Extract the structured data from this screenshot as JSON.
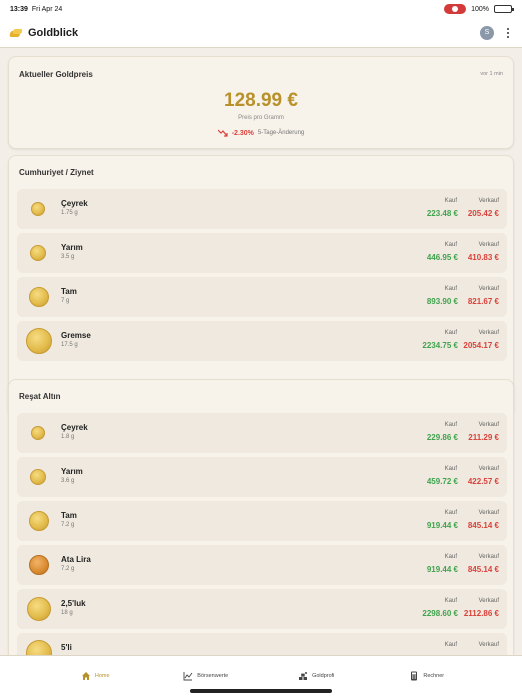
{
  "status": {
    "time": "13:39",
    "date": "Fri Apr 24",
    "battery": "100%"
  },
  "app": {
    "title": "Goldblick",
    "avatar_letter": "S"
  },
  "price_card": {
    "title": "Aktueller Goldpreis",
    "updated": "vor 1 min",
    "price": "128.99 €",
    "price_label": "Preis pro Gramm",
    "change_pct": "-2.30%",
    "change_label": "5-Tage-Änderung"
  },
  "labels": {
    "kauf": "Kauf",
    "verkauf": "Verkauf"
  },
  "sections": [
    {
      "title": "Cumhuriyet / Ziynet",
      "rows": [
        {
          "name": "Çeyrek",
          "weight": "1.75 g",
          "kauf": "223.48 €",
          "verkauf": "205.42 €"
        },
        {
          "name": "Yarım",
          "weight": "3.5 g",
          "kauf": "446.95 €",
          "verkauf": "410.83 €"
        },
        {
          "name": "Tam",
          "weight": "7 g",
          "kauf": "893.90 €",
          "verkauf": "821.67 €"
        },
        {
          "name": "Gremse",
          "weight": "17.5 g",
          "kauf": "2234.75 €",
          "verkauf": "2054.17 €"
        }
      ]
    },
    {
      "title": "Reşat Altın",
      "rows": [
        {
          "name": "Çeyrek",
          "weight": "1.8 g",
          "kauf": "229.86 €",
          "verkauf": "211.29 €"
        },
        {
          "name": "Yarım",
          "weight": "3.6 g",
          "kauf": "459.72 €",
          "verkauf": "422.57 €"
        },
        {
          "name": "Tam",
          "weight": "7.2 g",
          "kauf": "919.44 €",
          "verkauf": "845.14 €"
        },
        {
          "name": "Ata Lira",
          "weight": "7.2 g",
          "kauf": "919.44 €",
          "verkauf": "845.14 €"
        },
        {
          "name": "2,5'luk",
          "weight": "18 g",
          "kauf": "2298.60 €",
          "verkauf": "2112.86 €"
        },
        {
          "name": "5'li",
          "weight": "",
          "kauf": "",
          "verkauf": ""
        }
      ]
    }
  ],
  "nav": [
    {
      "label": "Home",
      "icon": "home-icon",
      "active": true
    },
    {
      "label": "Börsenwerte",
      "icon": "chart-icon",
      "active": false
    },
    {
      "label": "Goldprofi",
      "icon": "goldprofi-icon",
      "active": false
    },
    {
      "label": "Rechner",
      "icon": "calculator-icon",
      "active": false
    }
  ],
  "colors": {
    "gold": "#b8912a",
    "buy": "#3fa34d",
    "sell": "#d9423a",
    "background": "#f3efe8"
  }
}
